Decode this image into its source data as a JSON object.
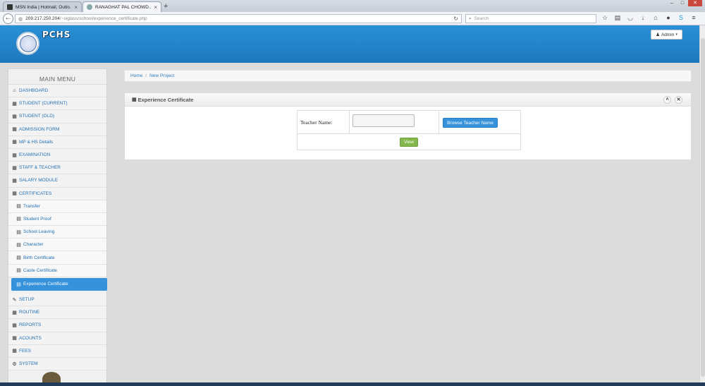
{
  "browser": {
    "tabs": [
      {
        "title": "MSN India | Hotmail, Outlo...",
        "active": false
      },
      {
        "title": "RANAGHAT PAL CHOWD...",
        "active": true
      }
    ],
    "new_tab": "+",
    "url_host": "209.217.250.204",
    "url_path": "/~siglass/school/experience_certificate.php",
    "search_placeholder": "Search"
  },
  "header": {
    "brand": "PCHS",
    "admin_label": "Admin"
  },
  "sidebar": {
    "title": "MAIN MENU",
    "items": [
      {
        "label": "DASHBOARD",
        "icon": "home-icon",
        "level": "top"
      },
      {
        "label": "STUDENT (CURRENT)",
        "icon": "grid-icon",
        "level": "top"
      },
      {
        "label": "STUDENT (OLD)",
        "icon": "grid-icon",
        "level": "top"
      },
      {
        "label": "ADMISSION FORM",
        "icon": "grid-icon",
        "level": "top"
      },
      {
        "label": "MP & HS Details",
        "icon": "grid-icon",
        "level": "top"
      },
      {
        "label": "EXAMINATION",
        "icon": "grid-icon",
        "level": "top"
      },
      {
        "label": "STAFF & TEACHER",
        "icon": "grid-icon",
        "level": "top"
      },
      {
        "label": "SALARY MODULE",
        "icon": "grid-icon",
        "level": "top"
      },
      {
        "label": "CERTIFICATES",
        "icon": "grid-icon",
        "level": "top"
      },
      {
        "label": "Transfer",
        "icon": "list-icon",
        "level": "sub"
      },
      {
        "label": "Student Proof",
        "icon": "list-icon",
        "level": "sub"
      },
      {
        "label": "School Leaving",
        "icon": "list-icon",
        "level": "sub"
      },
      {
        "label": "Character",
        "icon": "list-icon",
        "level": "sub"
      },
      {
        "label": "Birth Certificate",
        "icon": "list-icon",
        "level": "sub"
      },
      {
        "label": "Caste Certificate",
        "icon": "list-icon",
        "level": "sub"
      },
      {
        "label": "Experience Certificate",
        "icon": "list-icon",
        "level": "sub",
        "active": true
      },
      {
        "label": "SETUP",
        "icon": "wrench-icon",
        "level": "top"
      },
      {
        "label": "ROUTINE",
        "icon": "grid-icon",
        "level": "top"
      },
      {
        "label": "REPORTS",
        "icon": "grid-icon",
        "level": "top"
      },
      {
        "label": "ACOUNTS",
        "icon": "grid-icon",
        "level": "top"
      },
      {
        "label": "FEES",
        "icon": "grid-icon",
        "level": "top"
      },
      {
        "label": "SYSTEM",
        "icon": "gears-icon",
        "level": "top"
      }
    ]
  },
  "breadcrumb": {
    "home": "Home",
    "separator": "/",
    "current": "New Project"
  },
  "panel": {
    "title": "Experience Certificate",
    "teacher_label": "Teacher Name:",
    "teacher_value": "",
    "browse_label": "Browse Teacher Name",
    "view_label": "View"
  },
  "colors": {
    "header_blue": "#2a90d6",
    "active_blue": "#3592db",
    "view_green": "#82b74b",
    "link_blue": "#1f6fb3"
  }
}
